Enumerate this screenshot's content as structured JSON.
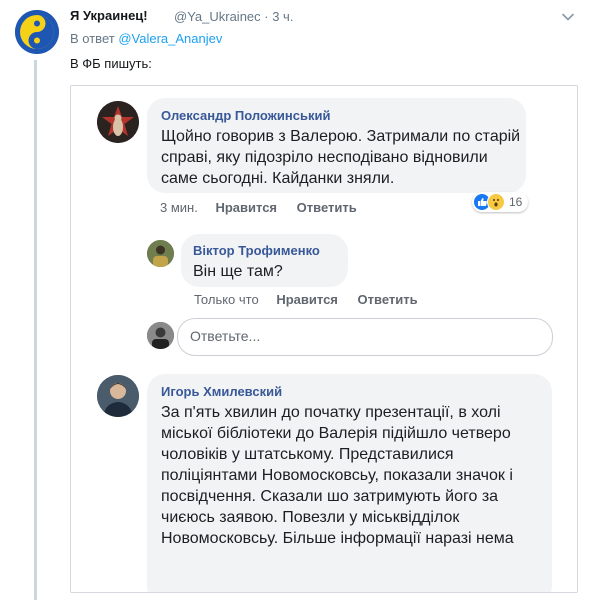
{
  "tweet": {
    "author_name": "Я Украинец!",
    "author_handle": "@Ya_Ukrainec · 3 ч.",
    "reply_prefix": "В ответ",
    "reply_handle": "@Valera_Ananjev",
    "text": "В ФБ пишуть:",
    "icons": [
      "yin-yang-avatar-icon",
      "chevron-down-icon"
    ],
    "colors": {
      "link": "#1da1f2",
      "thread_line": "#ccd6dd"
    }
  },
  "fb": {
    "comment1": {
      "author": "Олександр Положинський",
      "text": "Щойно говорив з Валерою. Затримали по старій справі, яку підозріло несподівано відновили саме сьогодні. Кайданки зняли.",
      "time": "3 мин.",
      "like": "Нравится",
      "reply": "Ответить",
      "reactions_count": "16",
      "reactions": [
        "like-reaction-icon",
        "wow-reaction-icon"
      ]
    },
    "comment2": {
      "author": "Віктор Трофименко",
      "text": "Він ще там?",
      "time": "Только что",
      "like": "Нравится",
      "reply": "Ответить"
    },
    "reply_box": {
      "placeholder": "Ответьте..."
    },
    "comment3": {
      "author": "Игорь Хмилевский",
      "text": "За п'ять хвилин до початку презентації, в холі міської бібліотеки  до Валерія підійшло четверо чоловіків у штатському. Представилися поліціянтами Новомосковсьу, показали значок і посвідчення. Сказали шо затримують його за чиєюсь заявою. Повезли у міськвідділок Новомосковсьу. Більше інформації наразі нема"
    },
    "colors": {
      "name": "#385898",
      "bubble": "#f2f3f5",
      "meta": "#606770"
    }
  }
}
